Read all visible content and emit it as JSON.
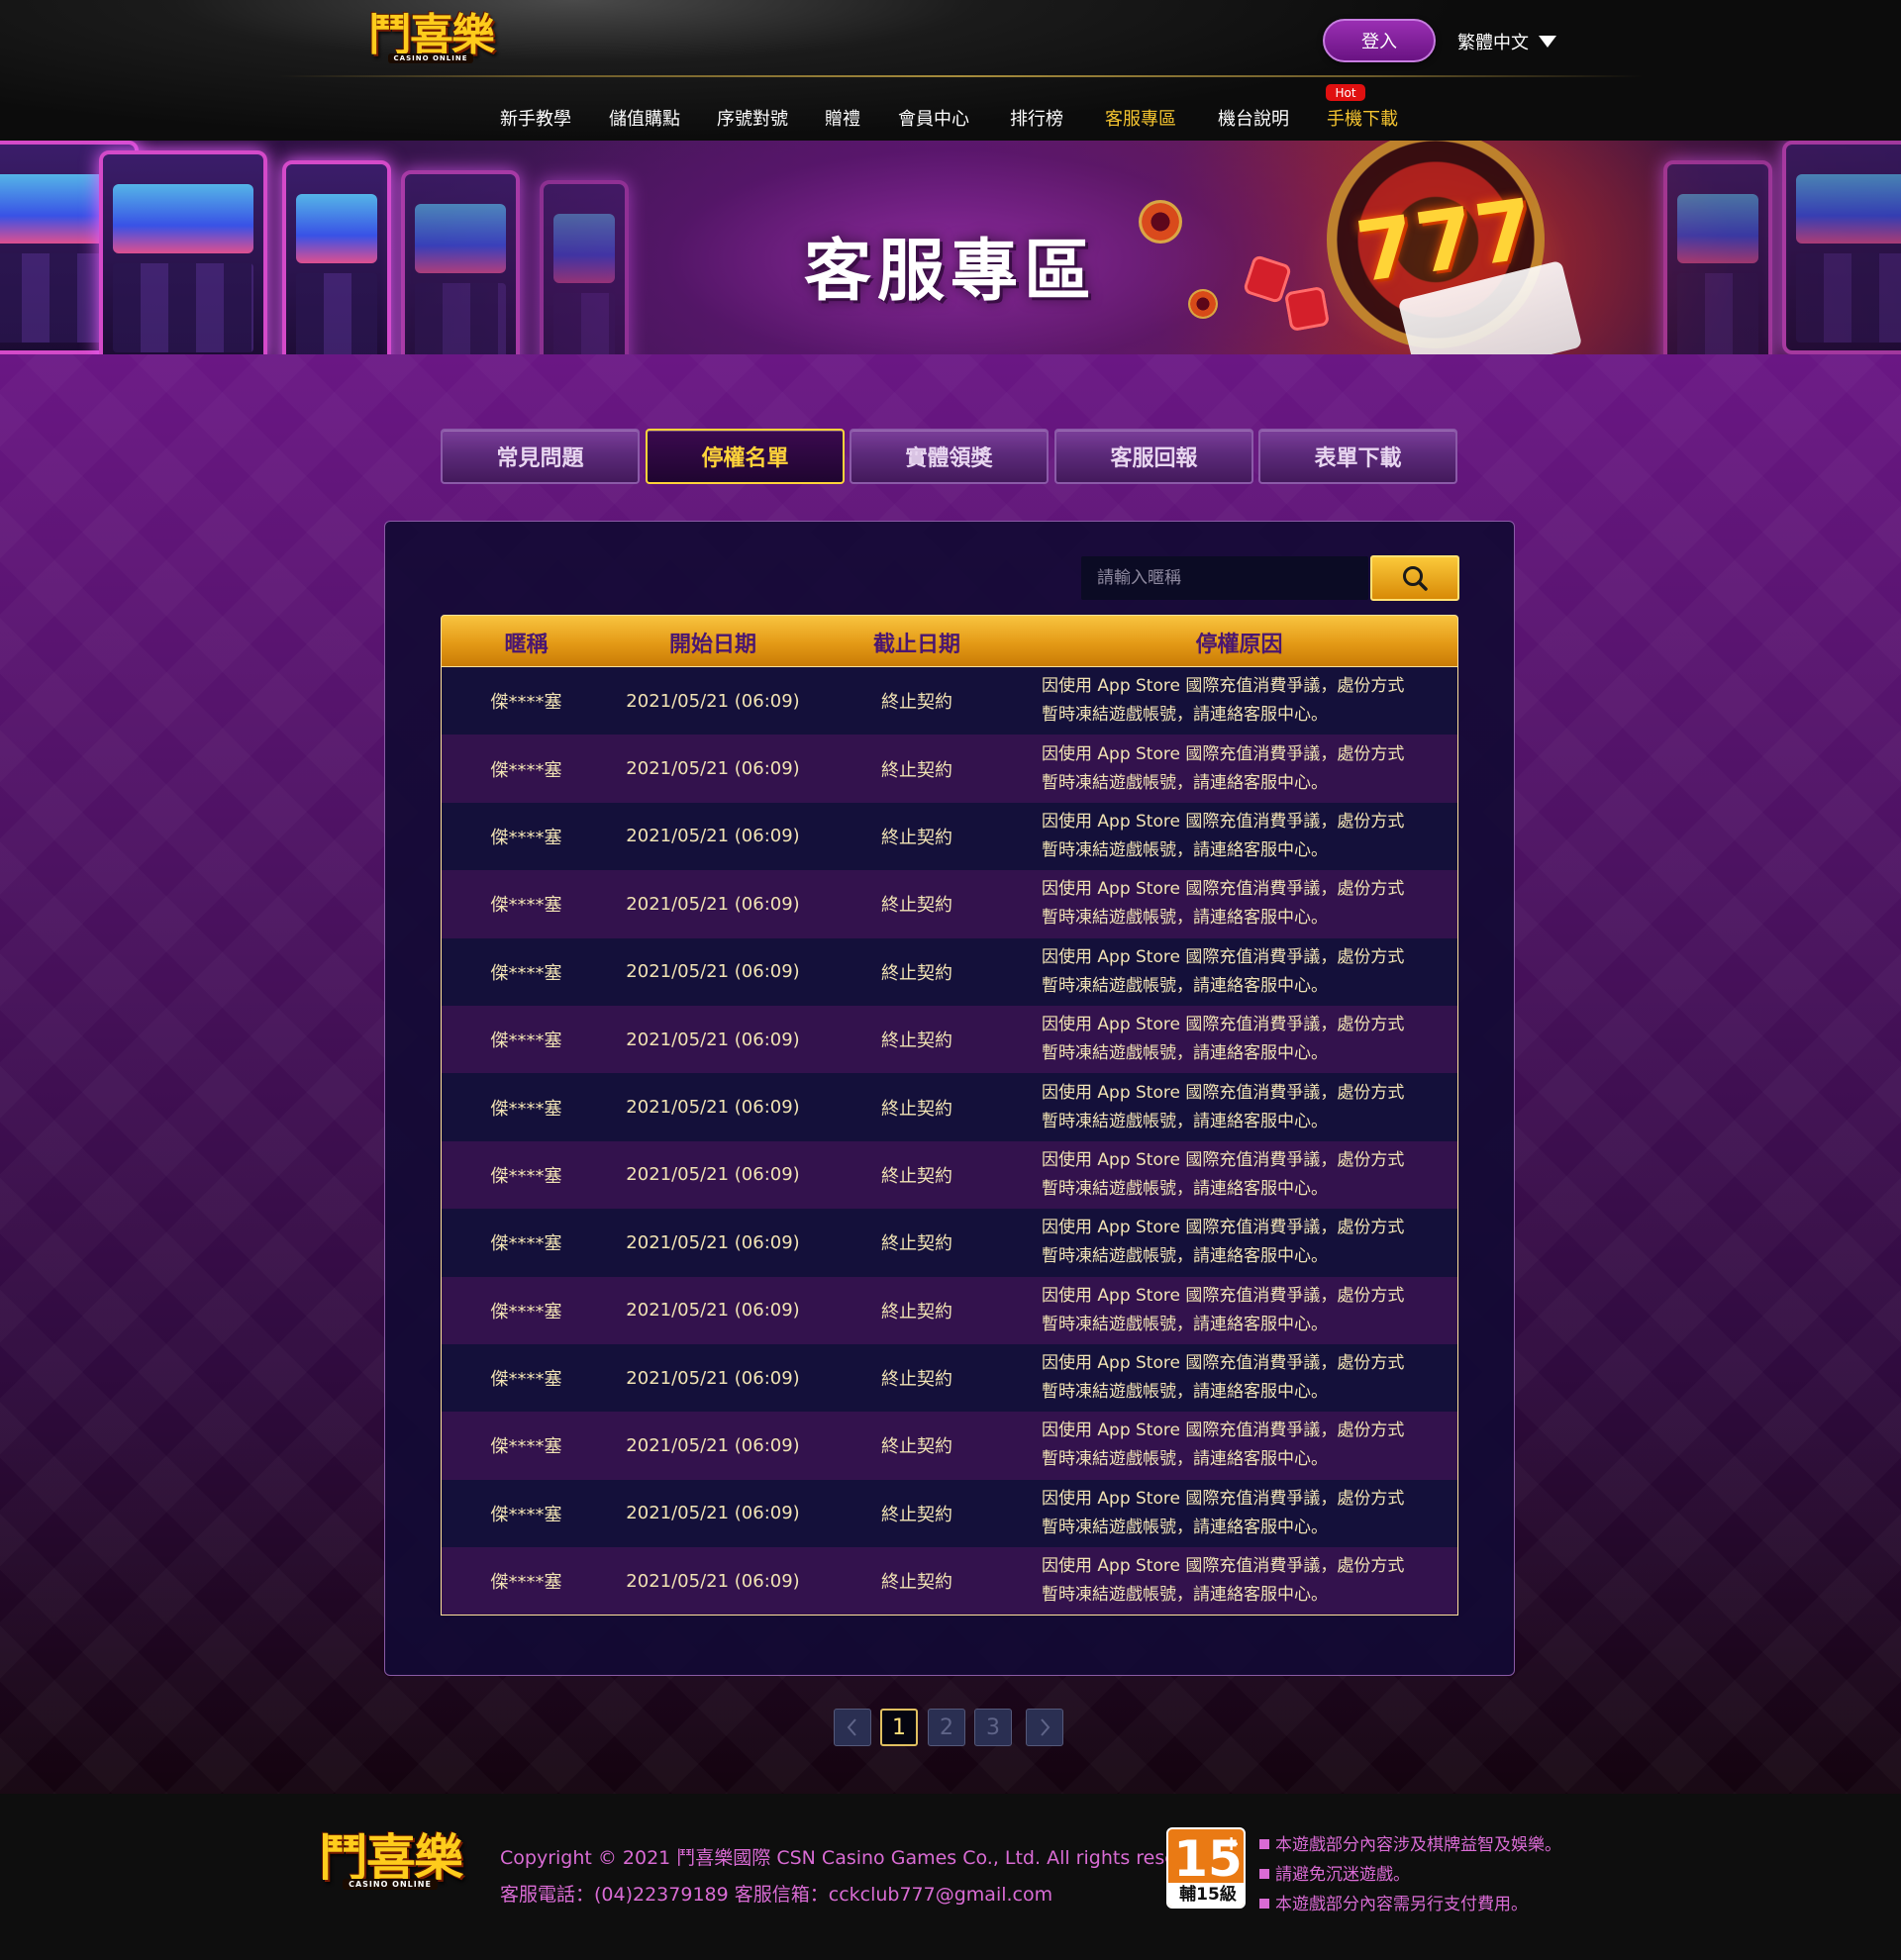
{
  "brand": {
    "logo_text": "鬥喜樂",
    "logo_sub": "CASINO ONLINE"
  },
  "header": {
    "login_label": "登入",
    "language": "繁體中文"
  },
  "nav": {
    "items": [
      {
        "label": "新手教學"
      },
      {
        "label": "儲值購點"
      },
      {
        "label": "序號對號"
      },
      {
        "label": "贈禮"
      },
      {
        "label": "會員中心"
      },
      {
        "label": "排行榜"
      },
      {
        "label": "客服專區"
      },
      {
        "label": "機台說明"
      },
      {
        "label": "手機下載"
      }
    ],
    "active_index": 6,
    "hot_badge": "Hot"
  },
  "banner": {
    "title": "客服專區"
  },
  "tabs": {
    "items": [
      {
        "label": "常見問題"
      },
      {
        "label": "停權名單"
      },
      {
        "label": "實體領獎"
      },
      {
        "label": "客服回報"
      },
      {
        "label": "表單下載"
      }
    ],
    "active_index": 1
  },
  "search": {
    "placeholder": "請輸入暱稱",
    "value": ""
  },
  "table": {
    "headers": [
      "暱稱",
      "開始日期",
      "截止日期",
      "停權原因"
    ],
    "rows": [
      {
        "nickname": "傑****塞",
        "start": "2021/05/21 (06:09)",
        "end": "終止契約",
        "reason": "因使用 App Store 國際充值消費爭議，處份方式\n暫時凍結遊戲帳號，請連絡客服中心。"
      },
      {
        "nickname": "傑****塞",
        "start": "2021/05/21 (06:09)",
        "end": "終止契約",
        "reason": "因使用 App Store 國際充值消費爭議，處份方式\n暫時凍結遊戲帳號，請連絡客服中心。"
      },
      {
        "nickname": "傑****塞",
        "start": "2021/05/21 (06:09)",
        "end": "終止契約",
        "reason": "因使用 App Store 國際充值消費爭議，處份方式\n暫時凍結遊戲帳號，請連絡客服中心。"
      },
      {
        "nickname": "傑****塞",
        "start": "2021/05/21 (06:09)",
        "end": "終止契約",
        "reason": "因使用 App Store 國際充值消費爭議，處份方式\n暫時凍結遊戲帳號，請連絡客服中心。"
      },
      {
        "nickname": "傑****塞",
        "start": "2021/05/21 (06:09)",
        "end": "終止契約",
        "reason": "因使用 App Store 國際充值消費爭議，處份方式\n暫時凍結遊戲帳號，請連絡客服中心。"
      },
      {
        "nickname": "傑****塞",
        "start": "2021/05/21 (06:09)",
        "end": "終止契約",
        "reason": "因使用 App Store 國際充值消費爭議，處份方式\n暫時凍結遊戲帳號，請連絡客服中心。"
      },
      {
        "nickname": "傑****塞",
        "start": "2021/05/21 (06:09)",
        "end": "終止契約",
        "reason": "因使用 App Store 國際充值消費爭議，處份方式\n暫時凍結遊戲帳號，請連絡客服中心。"
      },
      {
        "nickname": "傑****塞",
        "start": "2021/05/21 (06:09)",
        "end": "終止契約",
        "reason": "因使用 App Store 國際充值消費爭議，處份方式\n暫時凍結遊戲帳號，請連絡客服中心。"
      },
      {
        "nickname": "傑****塞",
        "start": "2021/05/21 (06:09)",
        "end": "終止契約",
        "reason": "因使用 App Store 國際充值消費爭議，處份方式\n暫時凍結遊戲帳號，請連絡客服中心。"
      },
      {
        "nickname": "傑****塞",
        "start": "2021/05/21 (06:09)",
        "end": "終止契約",
        "reason": "因使用 App Store 國際充值消費爭議，處份方式\n暫時凍結遊戲帳號，請連絡客服中心。"
      },
      {
        "nickname": "傑****塞",
        "start": "2021/05/21 (06:09)",
        "end": "終止契約",
        "reason": "因使用 App Store 國際充值消費爭議，處份方式\n暫時凍結遊戲帳號，請連絡客服中心。"
      },
      {
        "nickname": "傑****塞",
        "start": "2021/05/21 (06:09)",
        "end": "終止契約",
        "reason": "因使用 App Store 國際充值消費爭議，處份方式\n暫時凍結遊戲帳號，請連絡客服中心。"
      },
      {
        "nickname": "傑****塞",
        "start": "2021/05/21 (06:09)",
        "end": "終止契約",
        "reason": "因使用 App Store 國際充值消費爭議，處份方式\n暫時凍結遊戲帳號，請連絡客服中心。"
      },
      {
        "nickname": "傑****塞",
        "start": "2021/05/21 (06:09)",
        "end": "終止契約",
        "reason": "因使用 App Store 國際充值消費爭議，處份方式\n暫時凍結遊戲帳號，請連絡客服中心。"
      }
    ]
  },
  "pagination": {
    "pages": [
      "1",
      "2",
      "3"
    ],
    "current": "1"
  },
  "footer": {
    "copyright": "Copyright © 2021   鬥喜樂國際 CSN Casino Games Co., Ltd. All rights reserved.",
    "contact": "客服電話：(04)22379189    客服信箱：cckclub777@gmail.com",
    "rating_number": "15",
    "rating_plus": "+",
    "rating_label": "輔15級",
    "notes": [
      "本遊戲部分內容涉及棋牌益智及娛樂。",
      "請避免沉迷遊戲。",
      "本遊戲部分內容需另行支付費用。"
    ]
  },
  "colors": {
    "accent_gold": "#f4c430",
    "header_bar_gold": "#e49a16",
    "tab_purple": "#5c2a7a",
    "panel_navy": "#120a34",
    "footer_pink": "#d96bd4"
  },
  "icons": {
    "search": "search-icon",
    "language_dropdown": "chevron-down-icon",
    "prev_page": "chevron-left-icon",
    "next_page": "chevron-right-icon"
  }
}
